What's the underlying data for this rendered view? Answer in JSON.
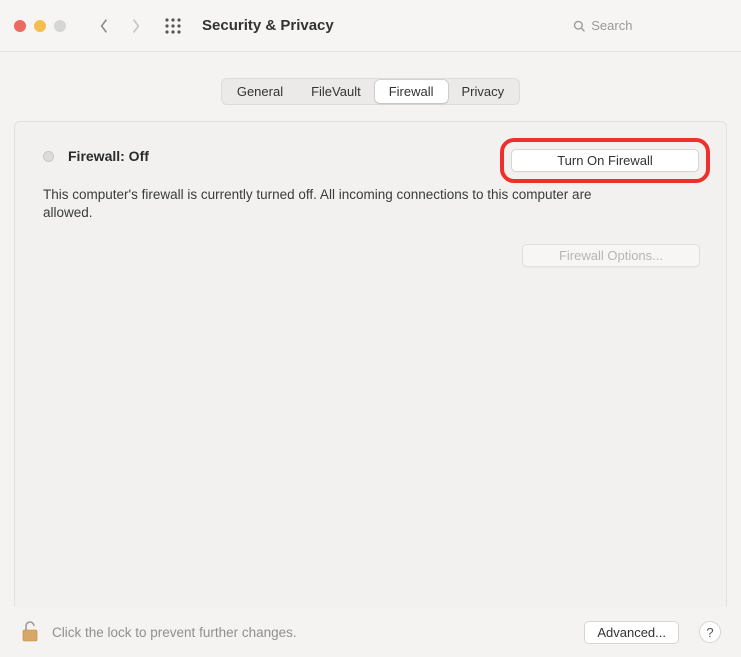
{
  "header": {
    "title": "Security & Privacy",
    "search_placeholder": "Search"
  },
  "tabs": {
    "general": "General",
    "filevault": "FileVault",
    "firewall": "Firewall",
    "privacy": "Privacy"
  },
  "main": {
    "status_label": "Firewall: Off",
    "turn_on_button": "Turn On Firewall",
    "description": "This computer's firewall is currently turned off. All incoming connections to this computer are allowed.",
    "options_button": "Firewall Options..."
  },
  "footer": {
    "lock_text": "Click the lock to prevent further changes.",
    "advanced_button": "Advanced...",
    "help_button": "?"
  }
}
